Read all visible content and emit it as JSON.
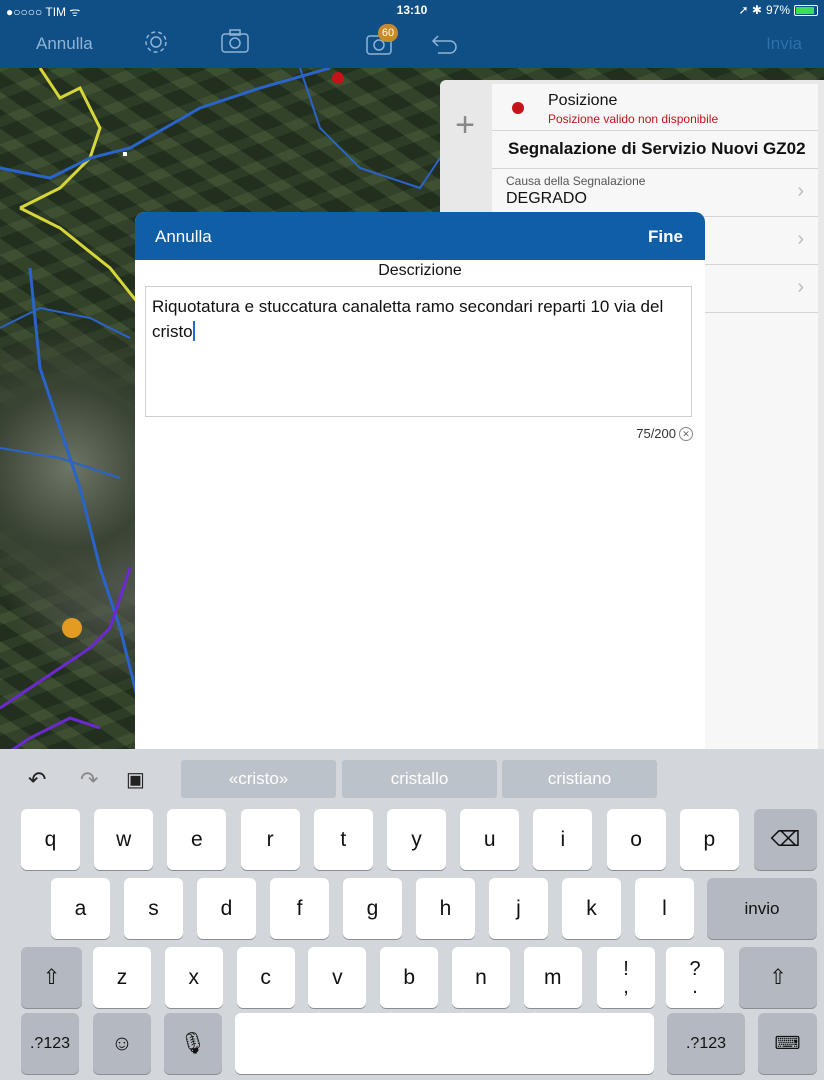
{
  "status_bar": {
    "carrier": "●○○○○ TIM ᯤ",
    "time": "13:10",
    "battery": "97%",
    "icons": "➚ ✱"
  },
  "nav": {
    "cancel": "Annulla",
    "send": "Invia",
    "badge": "60"
  },
  "panel": {
    "position_title": "Posizione",
    "position_status": "Posizione valido non disponibile",
    "form_title": "Segnalazione di Servizio Nuovi GZ02",
    "field_label": "Causa della Segnalazione",
    "field_value": "DEGRADO"
  },
  "modal": {
    "cancel": "Annulla",
    "done": "Fine",
    "title": "Descrizione",
    "text": "Riquotatura e stuccatura canaletta ramo secondari reparti 10 via del cristo",
    "counter": "75/200"
  },
  "keyboard": {
    "suggestions": [
      "«cristo»",
      "cristallo",
      "cristiano"
    ],
    "row1": [
      "q",
      "w",
      "e",
      "r",
      "t",
      "y",
      "u",
      "i",
      "o",
      "p"
    ],
    "row2": [
      "a",
      "s",
      "d",
      "f",
      "g",
      "h",
      "j",
      "k",
      "l"
    ],
    "row3": [
      "z",
      "x",
      "c",
      "v",
      "b",
      "n",
      "m"
    ],
    "punct1": "!",
    "punct1_sub": ",",
    "punct2": "?",
    "punct2_sub": ".",
    "return": "invio",
    "numbers": ".?123"
  },
  "colors": {
    "nav_bg": "#0f4f86",
    "modal_bar": "#0f5ea6",
    "red_dot": "#c4141a"
  }
}
